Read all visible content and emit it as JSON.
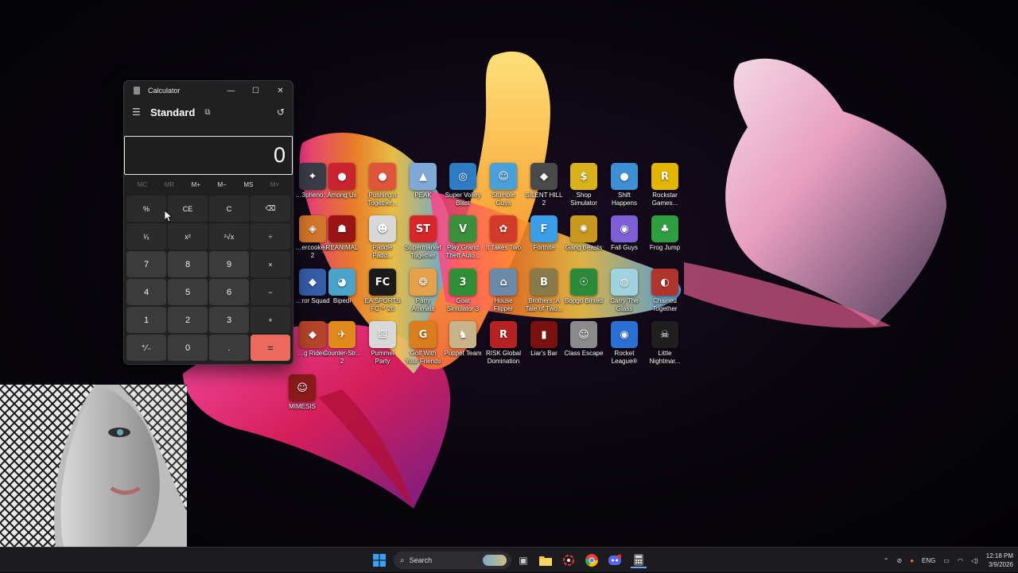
{
  "calculator": {
    "window_title": "Calculator",
    "mode": "Standard",
    "display": "0",
    "memory_buttons": [
      "MC",
      "MR",
      "M+",
      "M−",
      "MS",
      "M˅"
    ],
    "keys": [
      "%",
      "CE",
      "C",
      "⌫",
      "¹⁄ₓ",
      "x²",
      "²√x",
      "÷",
      "7",
      "8",
      "9",
      "×",
      "4",
      "5",
      "6",
      "−",
      "1",
      "2",
      "3",
      "+",
      "⁺∕₋",
      "0",
      ".",
      "="
    ]
  },
  "desktop_icons": [
    {
      "label": "…3pheno…",
      "color": "#3b3b46",
      "glyph": "✦"
    },
    {
      "label": "Among Us",
      "color": "#c8232f",
      "glyph": "●"
    },
    {
      "label": "Pushing it\nTogether...",
      "color": "#e0543b",
      "glyph": "●"
    },
    {
      "label": "PEAK",
      "color": "#7fa9d6",
      "glyph": "▲"
    },
    {
      "label": "Super Volley\nBlast",
      "color": "#2e7cc2",
      "glyph": "◎"
    },
    {
      "label": "Stumble\nGuys",
      "color": "#4aa0d8",
      "glyph": "☺"
    },
    {
      "label": "SILENT HILL\n2",
      "color": "#4a4a4a",
      "glyph": "◆"
    },
    {
      "label": "Shop\nSimulator",
      "color": "#d7b21a",
      "glyph": "$"
    },
    {
      "label": "Shift\nHappens",
      "color": "#3f8fd4",
      "glyph": "●"
    },
    {
      "label": "Rockstar\nGames...",
      "color": "#e2b600",
      "glyph": "R"
    },
    {
      "label": "…ercooked!\n2",
      "color": "#d0752a",
      "glyph": "◈"
    },
    {
      "label": "REANIMAL",
      "color": "#9a1414",
      "glyph": "☗"
    },
    {
      "label": "Paddle\nPadd...",
      "color": "#d8d8d8",
      "glyph": "☻"
    },
    {
      "label": "Supermarket\nTogether",
      "color": "#d9262b",
      "glyph": "ST"
    },
    {
      "label": "Play Grand\nTheft Auto...",
      "color": "#3a8f3a",
      "glyph": "V"
    },
    {
      "label": "It Takes Two",
      "color": "#d23a2c",
      "glyph": "✿"
    },
    {
      "label": "Fortnite",
      "color": "#3a9ee4",
      "glyph": "F"
    },
    {
      "label": "Gang Beasts",
      "color": "#c79a1e",
      "glyph": "✺"
    },
    {
      "label": "Fall Guys",
      "color": "#7c5fd6",
      "glyph": "◉"
    },
    {
      "label": "Frog Jump",
      "color": "#2f9e3f",
      "glyph": "♣"
    },
    {
      "label": "…ror Squad",
      "color": "#355ca6",
      "glyph": "◆"
    },
    {
      "label": "Bipedi",
      "color": "#4aa3c9",
      "glyph": "◕"
    },
    {
      "label": "EA SPORTS\nFC™ 26",
      "color": "#1a1a1a",
      "glyph": "FC"
    },
    {
      "label": "Party\nAnimals",
      "color": "#e6a24a",
      "glyph": "❂"
    },
    {
      "label": "Goat\nSimulator 3",
      "color": "#2f8f35",
      "glyph": "3"
    },
    {
      "label": "House\nFlipper",
      "color": "#6b8aa8",
      "glyph": "⌂"
    },
    {
      "label": "Brothers: A\nTale of Two...",
      "color": "#8a7a4a",
      "glyph": "B"
    },
    {
      "label": "Bopgo Binted",
      "color": "#2a8a3a",
      "glyph": "☉"
    },
    {
      "label": "Carry The\nGlass",
      "color": "#9fd3e0",
      "glyph": "◍"
    },
    {
      "label": "Chained\nTogether",
      "color": "#b0342e",
      "glyph": "◐"
    },
    {
      "label": "…g Riders",
      "color": "#b5452a",
      "glyph": "◆"
    },
    {
      "label": "Counter-Str...\n2",
      "color": "#e08a1c",
      "glyph": "✈"
    },
    {
      "label": "Pummel\nParty",
      "color": "#d8d8d8",
      "glyph": "⚄"
    },
    {
      "label": "Golf With\nYour Friends",
      "color": "#d97d1e",
      "glyph": "G"
    },
    {
      "label": "Puppet Team",
      "color": "#c9b48a",
      "glyph": "♞"
    },
    {
      "label": "RISK Global\nDomination",
      "color": "#b42222",
      "glyph": "R"
    },
    {
      "label": "Liar's Bar",
      "color": "#7a1010",
      "glyph": "▮"
    },
    {
      "label": "Class Escape",
      "color": "#8b8b8b",
      "glyph": "☺"
    },
    {
      "label": "Rocket\nLeague®",
      "color": "#2a6fd2",
      "glyph": "◉"
    },
    {
      "label": "Little\nNightmar...",
      "color": "#1f1f1f",
      "glyph": "☠"
    },
    {
      "label": "MIMESIS",
      "color": "#8a1a1a",
      "glyph": "☺"
    }
  ],
  "taskbar": {
    "search_label": "Search",
    "language": "ENG",
    "time": "12:18 PM",
    "date": "3/9/2026"
  }
}
